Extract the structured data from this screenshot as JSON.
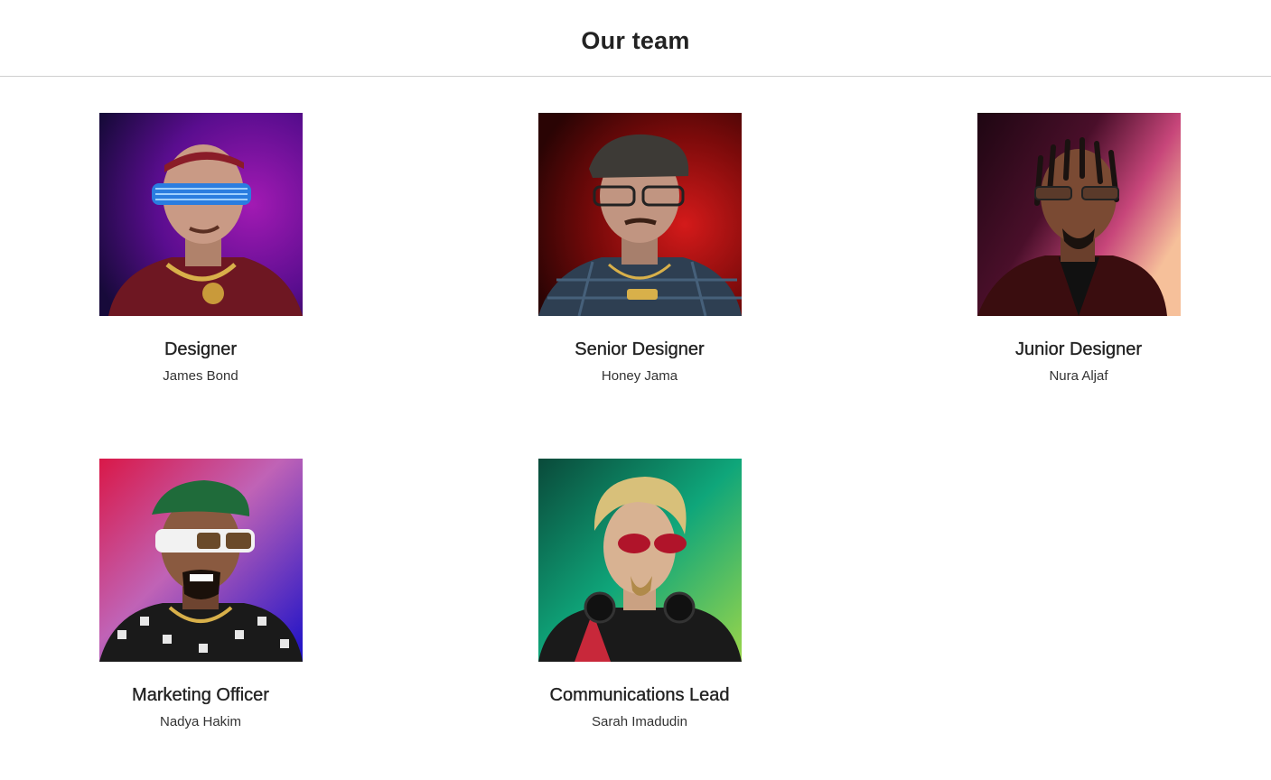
{
  "header": {
    "title": "Our team"
  },
  "team": [
    {
      "role": "Designer",
      "name": "James Bond",
      "portrait": "avatar-purple-shutter-shades"
    },
    {
      "role": "Senior Designer",
      "name": "Honey Jama",
      "portrait": "avatar-red-flat-cap"
    },
    {
      "role": "Junior Designer",
      "name": "Nura Aljaf",
      "portrait": "avatar-braids-sunset"
    },
    {
      "role": "Marketing Officer",
      "name": "Nadya Hakim",
      "portrait": "avatar-green-beret-white-shades"
    },
    {
      "role": "Communications Lead",
      "name": "Sarah Imadudin",
      "portrait": "avatar-blonde-headphones"
    }
  ],
  "colors": {
    "text": "#222222",
    "divider": "#cfcfcf",
    "background": "#ffffff"
  }
}
